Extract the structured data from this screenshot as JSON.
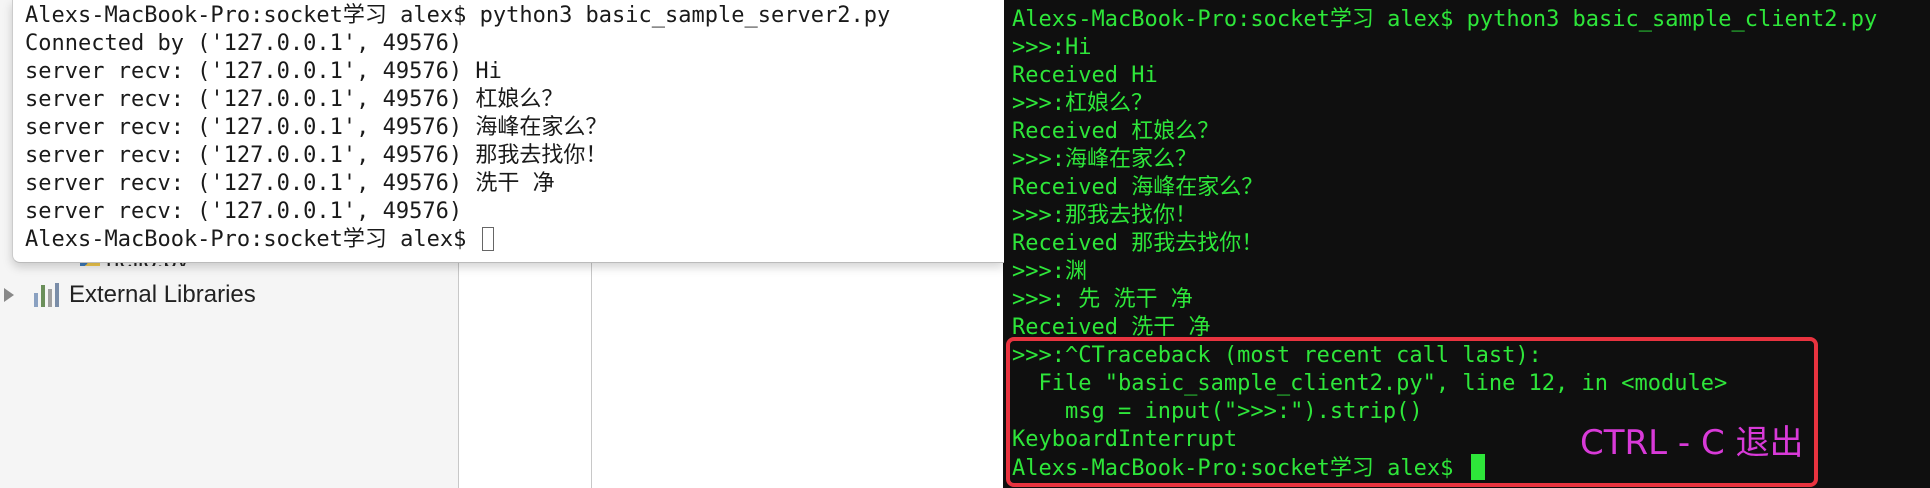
{
  "ide": {
    "tree_partial_label": "hello.py",
    "tree_item_label": "External Libraries"
  },
  "server_terminal": {
    "lines": [
      "Alexs-MacBook-Pro:socket学习 alex$ python3 basic_sample_server2.py",
      "Connected by ('127.0.0.1', 49576)",
      "server recv: ('127.0.0.1', 49576) Hi",
      "server recv: ('127.0.0.1', 49576) 杠娘么？",
      "server recv: ('127.0.0.1', 49576) 海峰在家么？",
      "server recv: ('127.0.0.1', 49576) 那我去找你！",
      "server recv: ('127.0.0.1', 49576) 洗干 净",
      "server recv: ('127.0.0.1', 49576)"
    ],
    "prompt": "Alexs-MacBook-Pro:socket学习 alex$ "
  },
  "client_terminal": {
    "lines": [
      "Alexs-MacBook-Pro:socket学习 alex$ python3 basic_sample_client2.py",
      ">>>:Hi",
      "Received Hi",
      ">>>:杠娘么？",
      "Received 杠娘么？",
      ">>>:海峰在家么？",
      "Received 海峰在家么？",
      ">>>:那我去找你！",
      "Received 那我去找你！",
      ">>>:渊",
      ">>>: 先 洗干 净",
      "Received 洗干 净",
      ">>>:^CTraceback (most recent call last):",
      "  File \"basic_sample_client2.py\", line 12, in <module>",
      "    msg = input(\">>>:\").strip()",
      "KeyboardInterrupt"
    ],
    "prompt": "Alexs-MacBook-Pro:socket学习 alex$ "
  },
  "annotation": {
    "text": "CTRL - C 退出",
    "color": "#d83ad8",
    "box_color": "#e8333f"
  },
  "colors": {
    "terminal_green": "#2ee63a",
    "terminal_bg": "#0f0f0f"
  }
}
